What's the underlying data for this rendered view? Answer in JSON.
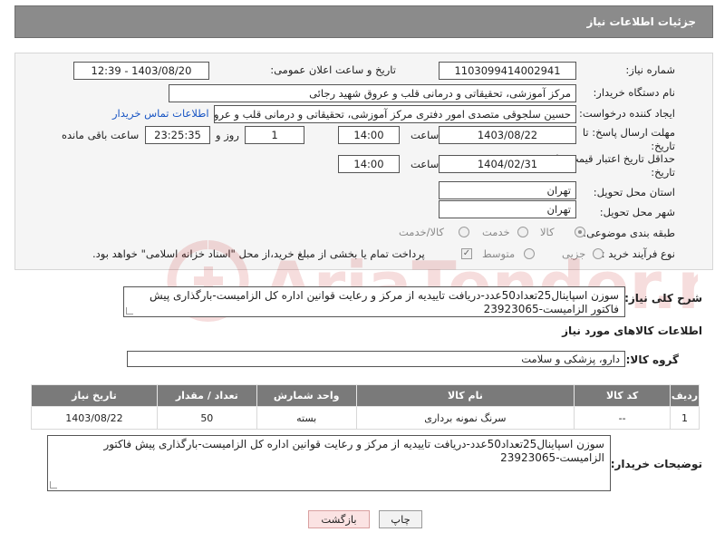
{
  "header": {
    "title": "جزئیات اطلاعات نیاز"
  },
  "form": {
    "need_number": {
      "label": "شماره نیاز:",
      "value": "1103099414002941"
    },
    "announce": {
      "label": "تاریخ و ساعت اعلان عمومی:",
      "value": "1403/08/20 - 12:39"
    },
    "buyer_org": {
      "label": "نام دستگاه خریدار:",
      "value": "مرکز آموزشی، تحقیقاتی و درمانی قلب و عروق شهید رجائی"
    },
    "creator": {
      "label": "ایجاد کننده درخواست:",
      "value": "حسین سلجوقی متصدی امور دفتری مرکز آموزشی، تحقیقاتی و درمانی قلب و عروق",
      "contact_link": "اطلاعات تماس خریدار"
    },
    "deadline": {
      "label_line1": "مهلت ارسال پاسخ: تا",
      "label_line2": "تاریخ:",
      "date": "1403/08/22",
      "time_label": "ساعت",
      "time": "14:00",
      "days": "1",
      "days_label": "روز و",
      "remaining": "23:25:35",
      "remaining_label": "ساعت باقی مانده"
    },
    "validity": {
      "label_line1": "حداقل تاریخ اعتبار قیمت: تا",
      "label_line2": "تاریخ:",
      "date": "1404/02/31",
      "time_label": "ساعت",
      "time": "14:00"
    },
    "province": {
      "label": "استان محل تحویل:",
      "value": "تهران"
    },
    "city": {
      "label": "شهر محل تحویل:",
      "value": "تهران"
    },
    "category": {
      "label": "طبقه بندی موضوعی:",
      "options": [
        "کالا",
        "خدمت",
        "کالا/خدمت"
      ]
    },
    "process": {
      "label": "نوع فرآیند خرید :",
      "options": [
        "جزیی",
        "متوسط"
      ],
      "note": "پرداخت تمام یا بخشی از مبلغ خرید،از محل \"اسناد خزانه اسلامی\" خواهد بود."
    }
  },
  "description": {
    "label": "شرح کلی نیاز:",
    "text": "سوزن اسپاینال25تعداد50عدد-دریافت تاییدیه از مرکز و رعایت قوانین اداره کل الزامیست-بارگذاری پیش فاکتور الزامیست-23923065"
  },
  "goods_info_title": "اطلاعات کالاهای مورد نیاز",
  "goods_group": {
    "label": "گروه کالا:",
    "value": "دارو، پزشکی و سلامت"
  },
  "table": {
    "headers": [
      "ردیف",
      "کد کالا",
      "نام کالا",
      "واحد شمارش",
      "تعداد / مقدار",
      "تاریخ نیاز"
    ],
    "rows": [
      [
        "1",
        "--",
        "سرنگ نمونه برداری",
        "بسته",
        "50",
        "1403/08/22"
      ]
    ]
  },
  "buyer_notes": {
    "label": "توضیحات خریدار:",
    "text": "سوزن اسپاینال25تعداد50عدد-دریافت تاییدیه از مرکز و رعایت قوانین اداره کل الزامیست-بارگذاری پیش فاکتور الزامیست-23923065"
  },
  "buttons": {
    "print": "چاپ",
    "back": "بازگشت"
  },
  "watermark": "AriaTender.neT",
  "colors": {
    "header_bg": "#8b8b8b",
    "table_header_bg": "#7a7a7a",
    "link": "#1a56c4",
    "back_button_bg": "#fbe3e3"
  }
}
